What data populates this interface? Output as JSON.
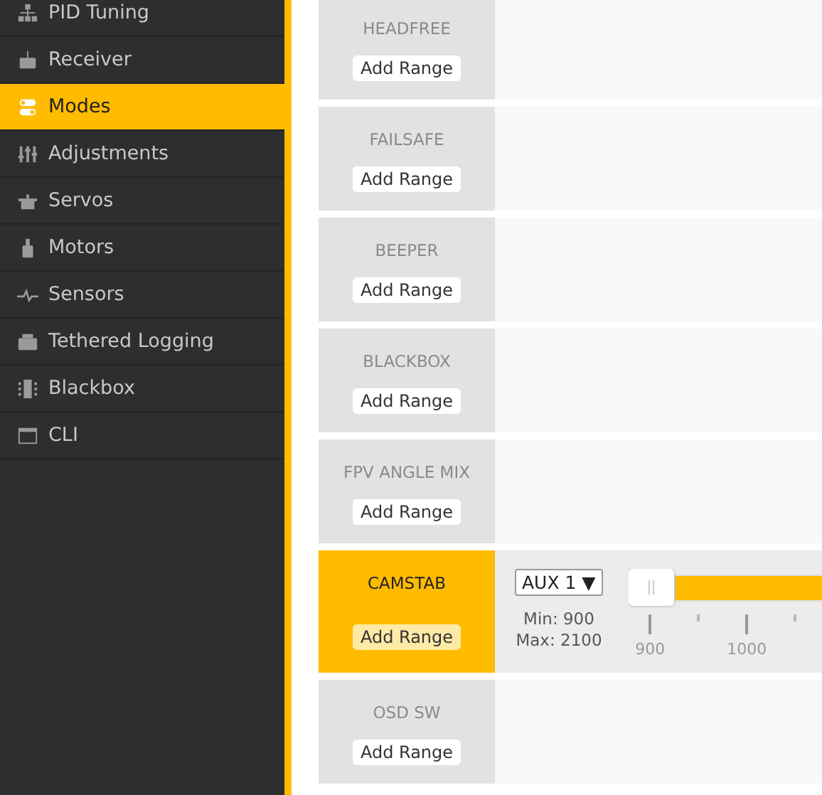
{
  "sidebar": {
    "items": [
      {
        "label": "PID Tuning",
        "selected": false
      },
      {
        "label": "Receiver",
        "selected": false
      },
      {
        "label": "Modes",
        "selected": true
      },
      {
        "label": "Adjustments",
        "selected": false
      },
      {
        "label": "Servos",
        "selected": false
      },
      {
        "label": "Motors",
        "selected": false
      },
      {
        "label": "Sensors",
        "selected": false
      },
      {
        "label": "Tethered Logging",
        "selected": false
      },
      {
        "label": "Blackbox",
        "selected": false
      },
      {
        "label": "CLI",
        "selected": false
      }
    ]
  },
  "modes": [
    {
      "name": "HEADFREE",
      "button": "Add Range",
      "active": false
    },
    {
      "name": "FAILSAFE",
      "button": "Add Range",
      "active": false
    },
    {
      "name": "BEEPER",
      "button": "Add Range",
      "active": false
    },
    {
      "name": "BLACKBOX",
      "button": "Add Range",
      "active": false
    },
    {
      "name": "FPV ANGLE MIX",
      "button": "Add Range",
      "active": false
    },
    {
      "name": "CAMSTAB",
      "button": "Add Range",
      "active": true,
      "range": {
        "channel": "AUX 1 ▼",
        "min": "Min: 900",
        "max": "Max: 2100",
        "level": 1,
        "ticks": [
          "900",
          "1000"
        ]
      }
    },
    {
      "name": "OSD SW",
      "button": "Add Range",
      "active": false
    }
  ]
}
